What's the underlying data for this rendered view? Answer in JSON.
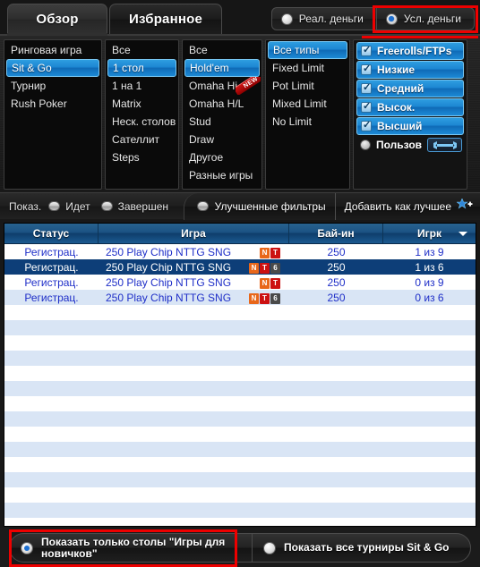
{
  "tabs": [
    {
      "label": "Обзор",
      "active": true
    },
    {
      "label": "Избранное",
      "active": false
    }
  ],
  "money_modes": [
    {
      "label": "Реал. деньги",
      "selected": false
    },
    {
      "label": "Усл. деньги",
      "selected": true
    }
  ],
  "filters": {
    "game_format": [
      {
        "label": "Ринговая игра",
        "selected": false
      },
      {
        "label": "Sit & Go",
        "selected": true
      },
      {
        "label": "Турнир",
        "selected": false
      },
      {
        "label": "Rush Poker",
        "selected": false
      }
    ],
    "table_count": [
      {
        "label": "Все",
        "selected": false
      },
      {
        "label": "1 стол",
        "selected": true
      },
      {
        "label": "1 на 1",
        "selected": false
      },
      {
        "label": "Matrix",
        "selected": false
      },
      {
        "label": "Неск. столов",
        "selected": false
      },
      {
        "label": "Сателлит",
        "selected": false
      },
      {
        "label": "Steps",
        "selected": false
      }
    ],
    "game_type": [
      {
        "label": "Все",
        "selected": false,
        "badge": ""
      },
      {
        "label": "Hold'em",
        "selected": true,
        "badge": ""
      },
      {
        "label": "Omaha Hi",
        "selected": false,
        "badge": "NEW"
      },
      {
        "label": "Omaha H/L",
        "selected": false,
        "badge": ""
      },
      {
        "label": "Stud",
        "selected": false,
        "badge": ""
      },
      {
        "label": "Draw",
        "selected": false,
        "badge": ""
      },
      {
        "label": "Другое",
        "selected": false,
        "badge": ""
      },
      {
        "label": "Разные игры",
        "selected": false,
        "badge": ""
      }
    ],
    "limit_type": [
      {
        "label": "Все типы",
        "selected": true
      },
      {
        "label": "Fixed Limit",
        "selected": false
      },
      {
        "label": "Pot Limit",
        "selected": false
      },
      {
        "label": "Mixed Limit",
        "selected": false
      },
      {
        "label": "No Limit",
        "selected": false
      }
    ],
    "stakes": [
      {
        "label": "Freerolls/FTPs",
        "checked": true,
        "control": "checkbox"
      },
      {
        "label": "Низкие",
        "checked": true,
        "control": "checkbox"
      },
      {
        "label": "Средний",
        "checked": true,
        "control": "checkbox"
      },
      {
        "label": "Высок.",
        "checked": true,
        "control": "checkbox"
      },
      {
        "label": "Высший",
        "checked": true,
        "control": "checkbox"
      },
      {
        "label": "Пользов",
        "checked": false,
        "control": "radio",
        "tool": "wrench-icon"
      }
    ]
  },
  "toolbar": {
    "show_label": "Показ.",
    "show_options": [
      {
        "label": "Идет",
        "on": false
      },
      {
        "label": "Завершен",
        "on": false
      }
    ],
    "advanced_filters_label": "Улучшенные фильтры",
    "advanced_filters_on": false,
    "add_as_best_label": "Добавить как лучшее"
  },
  "table": {
    "columns": [
      {
        "key": "status",
        "label": "Статус",
        "sorted": false
      },
      {
        "key": "game",
        "label": "Игра",
        "sorted": false
      },
      {
        "key": "buyin",
        "label": "Бай-ин",
        "sorted": false
      },
      {
        "key": "players",
        "label": "Игрк",
        "sorted": true
      }
    ],
    "rows": [
      {
        "status": "Регистрац.",
        "game": "250 Play Chip NTTG SNG",
        "badges": [
          "N",
          "T"
        ],
        "buyin": "250",
        "players": "1 из 9",
        "selected": false
      },
      {
        "status": "Регистрац.",
        "game": "250 Play Chip NTTG SNG",
        "badges": [
          "N",
          "T",
          "6"
        ],
        "buyin": "250",
        "players": "1 из 6",
        "selected": true
      },
      {
        "status": "Регистрац.",
        "game": "250 Play Chip NTTG SNG",
        "badges": [
          "N",
          "T"
        ],
        "buyin": "250",
        "players": "0 из 9",
        "selected": false
      },
      {
        "status": "Регистрац.",
        "game": "250 Play Chip NTTG SNG",
        "badges": [
          "N",
          "T",
          "6"
        ],
        "buyin": "250",
        "players": "0 из 6",
        "selected": false
      }
    ],
    "empty_rows": 15
  },
  "bottom": {
    "options": [
      {
        "label": "Показать только столы \"Игры для новичков\"",
        "selected": true
      },
      {
        "label": "Показать все турниры Sit & Go",
        "selected": false
      }
    ]
  },
  "colors": {
    "accent_blue": "#1c86d2",
    "header_blue": "#1b5283",
    "selected_row": "#0d3e78",
    "alt_row": "#d9e5f5",
    "highlight_red": "#ee0000",
    "badge_n": "#e8671a",
    "badge_t": "#cc1111",
    "badge_s": "#4a4a4a",
    "link_blue": "#1f2fc8"
  }
}
